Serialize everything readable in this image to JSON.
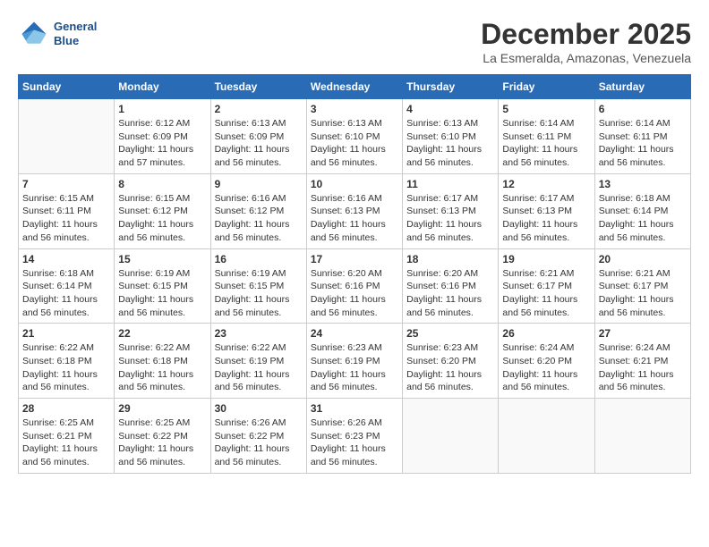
{
  "header": {
    "logo": {
      "line1": "General",
      "line2": "Blue"
    },
    "title": "December 2025",
    "subtitle": "La Esmeralda, Amazonas, Venezuela"
  },
  "calendar": {
    "days_of_week": [
      "Sunday",
      "Monday",
      "Tuesday",
      "Wednesday",
      "Thursday",
      "Friday",
      "Saturday"
    ],
    "weeks": [
      [
        {
          "day": "",
          "info": ""
        },
        {
          "day": "1",
          "info": "Sunrise: 6:12 AM\nSunset: 6:09 PM\nDaylight: 11 hours\nand 57 minutes."
        },
        {
          "day": "2",
          "info": "Sunrise: 6:13 AM\nSunset: 6:09 PM\nDaylight: 11 hours\nand 56 minutes."
        },
        {
          "day": "3",
          "info": "Sunrise: 6:13 AM\nSunset: 6:10 PM\nDaylight: 11 hours\nand 56 minutes."
        },
        {
          "day": "4",
          "info": "Sunrise: 6:13 AM\nSunset: 6:10 PM\nDaylight: 11 hours\nand 56 minutes."
        },
        {
          "day": "5",
          "info": "Sunrise: 6:14 AM\nSunset: 6:11 PM\nDaylight: 11 hours\nand 56 minutes."
        },
        {
          "day": "6",
          "info": "Sunrise: 6:14 AM\nSunset: 6:11 PM\nDaylight: 11 hours\nand 56 minutes."
        }
      ],
      [
        {
          "day": "7",
          "info": "Sunrise: 6:15 AM\nSunset: 6:11 PM\nDaylight: 11 hours\nand 56 minutes."
        },
        {
          "day": "8",
          "info": "Sunrise: 6:15 AM\nSunset: 6:12 PM\nDaylight: 11 hours\nand 56 minutes."
        },
        {
          "day": "9",
          "info": "Sunrise: 6:16 AM\nSunset: 6:12 PM\nDaylight: 11 hours\nand 56 minutes."
        },
        {
          "day": "10",
          "info": "Sunrise: 6:16 AM\nSunset: 6:13 PM\nDaylight: 11 hours\nand 56 minutes."
        },
        {
          "day": "11",
          "info": "Sunrise: 6:17 AM\nSunset: 6:13 PM\nDaylight: 11 hours\nand 56 minutes."
        },
        {
          "day": "12",
          "info": "Sunrise: 6:17 AM\nSunset: 6:13 PM\nDaylight: 11 hours\nand 56 minutes."
        },
        {
          "day": "13",
          "info": "Sunrise: 6:18 AM\nSunset: 6:14 PM\nDaylight: 11 hours\nand 56 minutes."
        }
      ],
      [
        {
          "day": "14",
          "info": "Sunrise: 6:18 AM\nSunset: 6:14 PM\nDaylight: 11 hours\nand 56 minutes."
        },
        {
          "day": "15",
          "info": "Sunrise: 6:19 AM\nSunset: 6:15 PM\nDaylight: 11 hours\nand 56 minutes."
        },
        {
          "day": "16",
          "info": "Sunrise: 6:19 AM\nSunset: 6:15 PM\nDaylight: 11 hours\nand 56 minutes."
        },
        {
          "day": "17",
          "info": "Sunrise: 6:20 AM\nSunset: 6:16 PM\nDaylight: 11 hours\nand 56 minutes."
        },
        {
          "day": "18",
          "info": "Sunrise: 6:20 AM\nSunset: 6:16 PM\nDaylight: 11 hours\nand 56 minutes."
        },
        {
          "day": "19",
          "info": "Sunrise: 6:21 AM\nSunset: 6:17 PM\nDaylight: 11 hours\nand 56 minutes."
        },
        {
          "day": "20",
          "info": "Sunrise: 6:21 AM\nSunset: 6:17 PM\nDaylight: 11 hours\nand 56 minutes."
        }
      ],
      [
        {
          "day": "21",
          "info": "Sunrise: 6:22 AM\nSunset: 6:18 PM\nDaylight: 11 hours\nand 56 minutes."
        },
        {
          "day": "22",
          "info": "Sunrise: 6:22 AM\nSunset: 6:18 PM\nDaylight: 11 hours\nand 56 minutes."
        },
        {
          "day": "23",
          "info": "Sunrise: 6:22 AM\nSunset: 6:19 PM\nDaylight: 11 hours\nand 56 minutes."
        },
        {
          "day": "24",
          "info": "Sunrise: 6:23 AM\nSunset: 6:19 PM\nDaylight: 11 hours\nand 56 minutes."
        },
        {
          "day": "25",
          "info": "Sunrise: 6:23 AM\nSunset: 6:20 PM\nDaylight: 11 hours\nand 56 minutes."
        },
        {
          "day": "26",
          "info": "Sunrise: 6:24 AM\nSunset: 6:20 PM\nDaylight: 11 hours\nand 56 minutes."
        },
        {
          "day": "27",
          "info": "Sunrise: 6:24 AM\nSunset: 6:21 PM\nDaylight: 11 hours\nand 56 minutes."
        }
      ],
      [
        {
          "day": "28",
          "info": "Sunrise: 6:25 AM\nSunset: 6:21 PM\nDaylight: 11 hours\nand 56 minutes."
        },
        {
          "day": "29",
          "info": "Sunrise: 6:25 AM\nSunset: 6:22 PM\nDaylight: 11 hours\nand 56 minutes."
        },
        {
          "day": "30",
          "info": "Sunrise: 6:26 AM\nSunset: 6:22 PM\nDaylight: 11 hours\nand 56 minutes."
        },
        {
          "day": "31",
          "info": "Sunrise: 6:26 AM\nSunset: 6:23 PM\nDaylight: 11 hours\nand 56 minutes."
        },
        {
          "day": "",
          "info": ""
        },
        {
          "day": "",
          "info": ""
        },
        {
          "day": "",
          "info": ""
        }
      ]
    ]
  }
}
